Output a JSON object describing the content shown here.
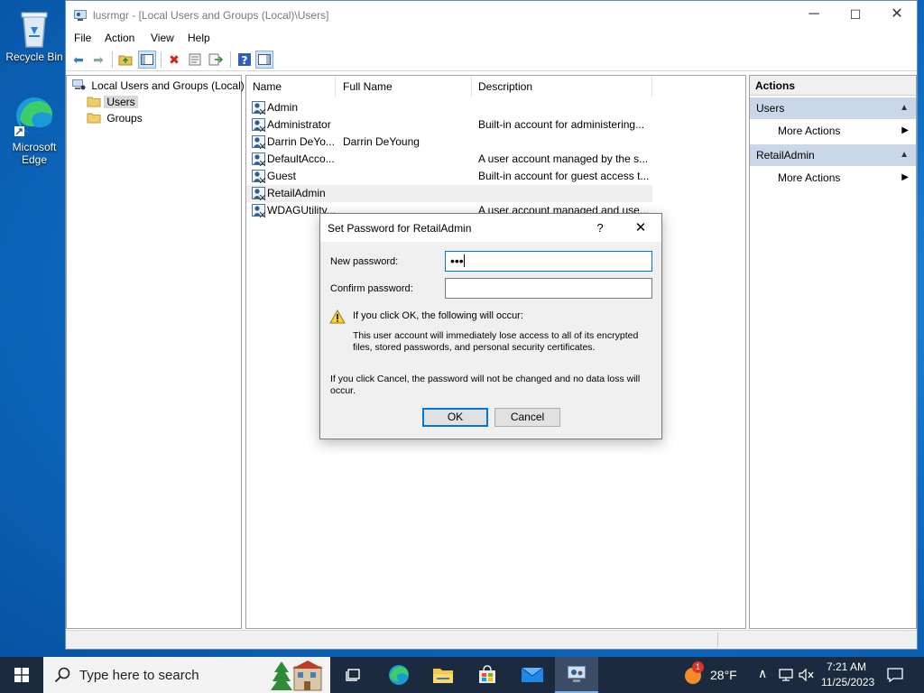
{
  "desktop": {
    "icons": [
      {
        "label": "Recycle Bin"
      },
      {
        "label": "Microsoft Edge"
      }
    ]
  },
  "window": {
    "title": "lusrmgr - [Local Users and Groups (Local)\\Users]",
    "controls": {
      "minimize": "─",
      "maximize": "☐",
      "close": "✕"
    },
    "menu": [
      "File",
      "Action",
      "View",
      "Help"
    ]
  },
  "tree": {
    "root": "Local Users and Groups (Local)",
    "children": [
      "Users",
      "Groups"
    ],
    "selected": "Users"
  },
  "list": {
    "columns": [
      "Name",
      "Full Name",
      "Description"
    ],
    "rows": [
      {
        "name": "Admin",
        "full_name": "",
        "description": ""
      },
      {
        "name": "Administrator",
        "full_name": "",
        "description": "Built-in account for administering..."
      },
      {
        "name": "Darrin DeYo...",
        "full_name": "Darrin DeYoung",
        "description": ""
      },
      {
        "name": "DefaultAcco...",
        "full_name": "",
        "description": "A user account managed by the s..."
      },
      {
        "name": "Guest",
        "full_name": "",
        "description": "Built-in account for guest access t..."
      },
      {
        "name": "RetailAdmin",
        "full_name": "",
        "description": ""
      },
      {
        "name": "WDAGUtility...",
        "full_name": "",
        "description": "A user account managed and use..."
      }
    ],
    "highlighted": "RetailAdmin"
  },
  "actions": {
    "header": "Actions",
    "groups": [
      {
        "title": "Users",
        "item": "More Actions"
      },
      {
        "title": "RetailAdmin",
        "item": "More Actions"
      }
    ]
  },
  "dialog": {
    "title": "Set Password for RetailAdmin",
    "help": "?",
    "close": "✕",
    "new_password_label": "New password:",
    "new_password_value": "•••",
    "confirm_password_label": "Confirm password:",
    "confirm_password_value": "",
    "warning_heading": "If you click OK, the following will occur:",
    "warning_line1": "This user account will immediately lose access to all of its encrypted",
    "warning_line2": "files, stored passwords, and personal security certificates.",
    "cancel_line1": "If you click Cancel, the password will not be changed and no data loss will",
    "cancel_line2": "occur.",
    "ok_label": "OK",
    "cancel_label": "Cancel"
  },
  "taskbar": {
    "search_placeholder": "Type here to search",
    "weather_badge": "1",
    "temperature": "28°F",
    "time": "7:21 AM",
    "date": "11/25/2023"
  },
  "colors": {
    "accent": "#0078d7",
    "actions_group_bg": "#c9d7e8",
    "taskbar_bg": "#1b2a3e",
    "desktop_bg": "#0f70c6"
  }
}
